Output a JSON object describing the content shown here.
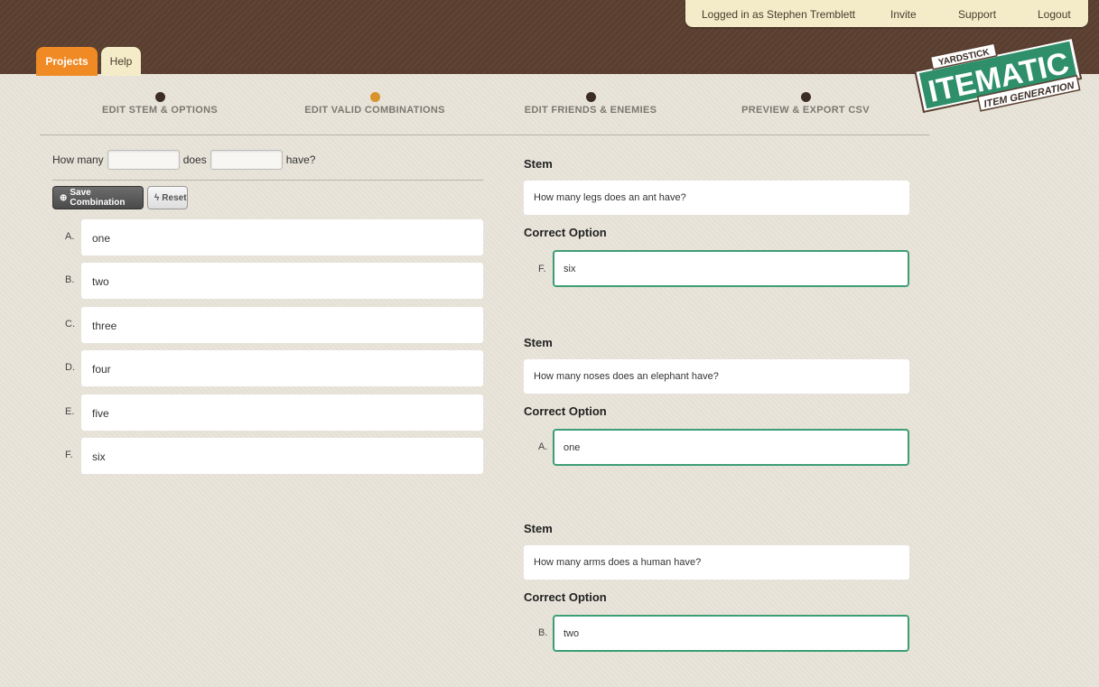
{
  "header": {
    "logged_in": "Logged in as Stephen Tremblett",
    "invite": "Invite",
    "support": "Support",
    "logout": "Logout",
    "tabs": [
      {
        "label": "Projects",
        "active": true
      },
      {
        "label": "Help",
        "active": false
      }
    ],
    "logo": {
      "top": "YARDSTICK",
      "main": "ITEMATIC",
      "bottom": "ITEM GENERATION"
    }
  },
  "steps": [
    {
      "label": "EDIT STEM & OPTIONS",
      "active": false
    },
    {
      "label": "EDIT VALID COMBINATIONS",
      "active": true
    },
    {
      "label": "EDIT FRIENDS & ENEMIES",
      "active": false
    },
    {
      "label": "PREVIEW & EXPORT CSV",
      "active": false
    }
  ],
  "template": {
    "word1": "How many",
    "word2": "does",
    "word3": "have?"
  },
  "buttons": {
    "save": "Save Combination",
    "reset": "Reset"
  },
  "options": [
    {
      "letter": "A.",
      "text": "one"
    },
    {
      "letter": "B.",
      "text": "two"
    },
    {
      "letter": "C.",
      "text": "three"
    },
    {
      "letter": "D.",
      "text": "four"
    },
    {
      "letter": "E.",
      "text": "five"
    },
    {
      "letter": "F.",
      "text": "six"
    }
  ],
  "combinations": [
    {
      "stem_label": "Stem",
      "stem": "How many legs does an ant have?",
      "correct_label": "Correct Option",
      "letter": "F.",
      "option": "six"
    },
    {
      "stem_label": "Stem",
      "stem": "How many noses does an elephant have?",
      "correct_label": "Correct Option",
      "letter": "A.",
      "option": "one"
    },
    {
      "stem_label": "Stem",
      "stem": "How many arms does a human have?",
      "correct_label": "Correct Option",
      "letter": "B.",
      "option": "two"
    }
  ],
  "colors": {
    "brown": "#5a3f30",
    "orange": "#f08a24",
    "green": "#3d9e76",
    "cream": "#f4ecc9"
  }
}
